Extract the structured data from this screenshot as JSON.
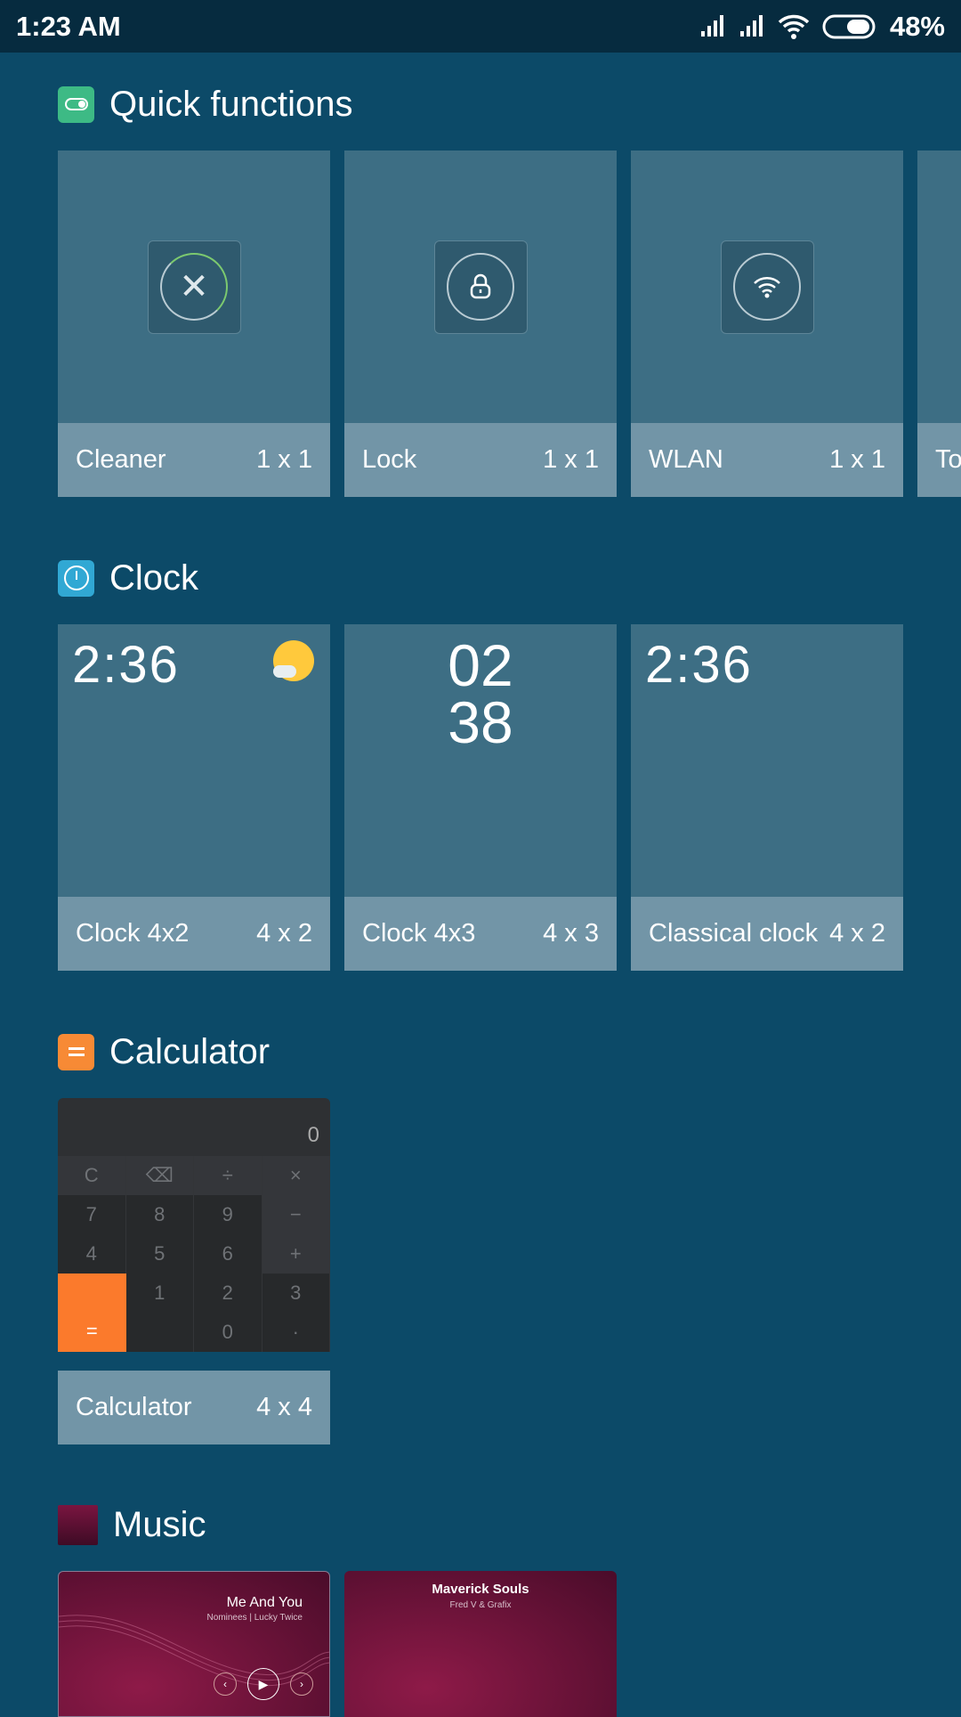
{
  "status_bar": {
    "time": "1:23 AM",
    "battery": "48%",
    "icons": [
      "signal-icon",
      "signal-icon",
      "wifi-icon",
      "battery-icon"
    ]
  },
  "sections": [
    {
      "title": "Quick functions",
      "icon": "toggle-icon",
      "color": "#3dba85",
      "cards": [
        {
          "name": "Cleaner",
          "size": "1 x 1",
          "icon": "close-icon"
        },
        {
          "name": "Lock",
          "size": "1 x 1",
          "icon": "lock-icon"
        },
        {
          "name": "WLAN",
          "size": "1 x 1",
          "icon": "wifi-icon"
        },
        {
          "name": "To",
          "size": ""
        }
      ]
    },
    {
      "title": "Clock",
      "icon": "clock-icon",
      "color": "#31a8d4",
      "cards": [
        {
          "name": "Clock 4x2",
          "size": "4 x 2",
          "time": "2:36"
        },
        {
          "name": "Clock 4x3",
          "size": "4 x 3",
          "hours": "02",
          "minutes": "38"
        },
        {
          "name": "Classical clock",
          "size": "4 x 2",
          "time": "2:36"
        }
      ]
    },
    {
      "title": "Calculator",
      "icon": "equals-icon",
      "color": "#f78a35",
      "cards": [
        {
          "name": "Calculator",
          "size": "4 x 4",
          "display": "0",
          "keys": [
            "C",
            "⌫",
            "÷",
            "×",
            "7",
            "8",
            "9",
            "−",
            "4",
            "5",
            "6",
            "+",
            "1",
            "2",
            "3",
            "=",
            "",
            "0",
            "·",
            ""
          ]
        }
      ]
    },
    {
      "title": "Music",
      "icon": "music-thumb-icon",
      "cards": [
        {
          "song": "Me And You",
          "artist": "Nominees | Lucky Twice"
        },
        {
          "song": "Maverick Souls",
          "artist": "Fred V & Grafix"
        }
      ]
    }
  ]
}
